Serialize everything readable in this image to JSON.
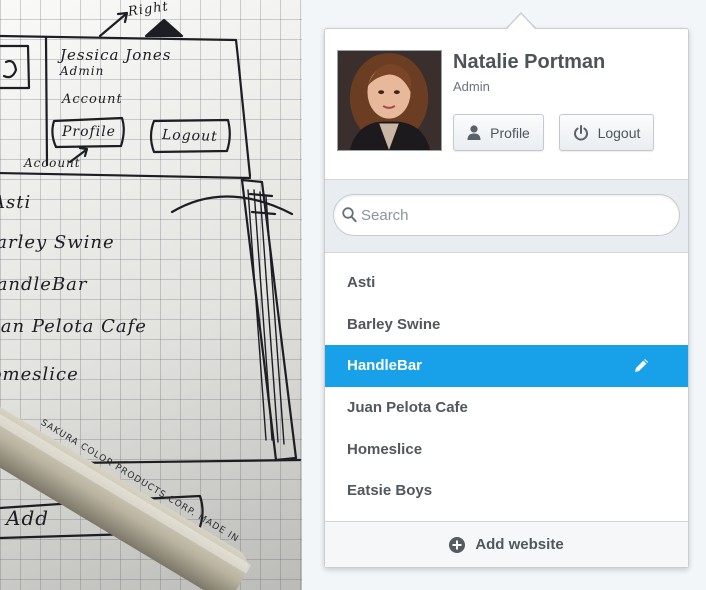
{
  "sketch": {
    "lines": [
      {
        "text": "Right",
        "tag": "arrow-label"
      },
      {
        "text": "Jessica Jones",
        "tag": "name"
      },
      {
        "text": "Admin",
        "tag": "role"
      },
      {
        "text": "Account",
        "tag": "account"
      },
      {
        "text": "Profile",
        "tag": "profile-btn"
      },
      {
        "text": "Logout",
        "tag": "logout-btn"
      },
      {
        "text": "Account",
        "tag": "account-note"
      },
      {
        "text": "Asti",
        "tag": "item-1"
      },
      {
        "text": "Barley Swine",
        "tag": "item-2"
      },
      {
        "text": "HandleBar",
        "tag": "item-3"
      },
      {
        "text": "Juan Pelota Cafe",
        "tag": "item-4"
      },
      {
        "text": "Homeslice",
        "tag": "item-5"
      },
      {
        "text": "Add",
        "tag": "add-btn"
      }
    ],
    "pen_brand": "SAKURA COLOR PRODUCTS CORP. MADE IN"
  },
  "user": {
    "name": "Natalie Portman",
    "role": "Admin",
    "avatar_icon": "user-photo"
  },
  "buttons": {
    "profile_label": "Profile",
    "profile_icon": "person-icon",
    "logout_label": "Logout",
    "logout_icon": "power-icon"
  },
  "search": {
    "placeholder": "Search",
    "value": "",
    "icon": "search-icon"
  },
  "sites": [
    {
      "label": "Asti",
      "active": false
    },
    {
      "label": "Barley Swine",
      "active": false
    },
    {
      "label": "HandleBar",
      "active": true,
      "icon": "pencil-icon"
    },
    {
      "label": "Juan Pelota Cafe",
      "active": false
    },
    {
      "label": "Homeslice",
      "active": false
    },
    {
      "label": "Eatsie Boys",
      "active": false
    }
  ],
  "footer": {
    "add_label": "Add website",
    "icon": "plus-circle-icon"
  },
  "colors": {
    "accent": "#18a0e8",
    "text": "#51575d",
    "panel_bg": "#ffffff",
    "bar_bg": "#e9edf1"
  }
}
